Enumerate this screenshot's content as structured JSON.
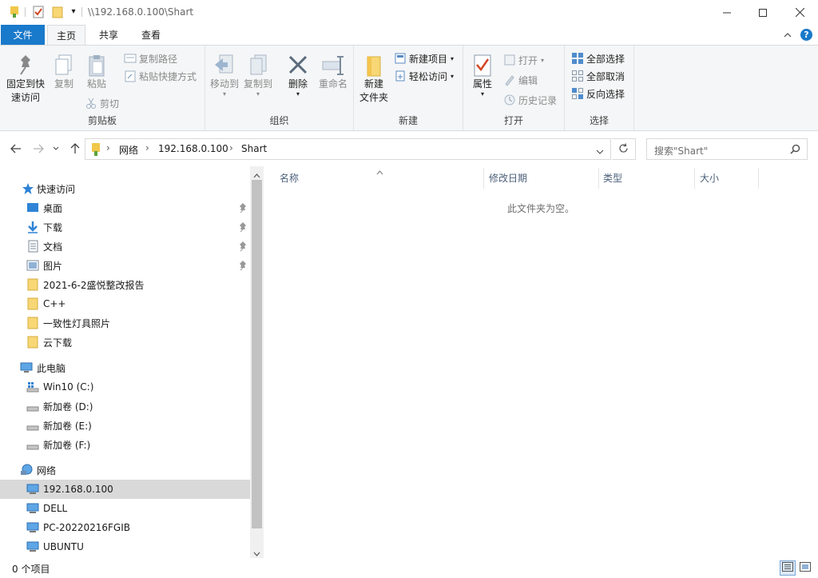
{
  "window": {
    "title": "\\\\192.168.0.100\\Shart"
  },
  "tabs": {
    "file": "文件",
    "home": "主页",
    "share": "共享",
    "view": "查看"
  },
  "ribbon": {
    "clipboard": {
      "label": "剪贴板",
      "pin_quick_access_line1": "固定到快",
      "pin_quick_access_line2": "速访问",
      "copy": "复制",
      "paste": "粘贴",
      "copy_path": "复制路径",
      "paste_shortcut": "粘贴快捷方式",
      "cut": "剪切"
    },
    "organize": {
      "label": "组织",
      "move_to": "移动到",
      "copy_to": "复制到",
      "delete": "删除",
      "rename": "重命名"
    },
    "new": {
      "label": "新建",
      "new_folder_line1": "新建",
      "new_folder_line2": "文件夹",
      "new_item": "新建项目",
      "easy_access": "轻松访问"
    },
    "open": {
      "label": "打开",
      "properties": "属性",
      "open": "打开",
      "edit": "编辑",
      "history": "历史记录"
    },
    "select": {
      "label": "选择",
      "select_all": "全部选择",
      "select_none": "全部取消",
      "invert": "反向选择"
    }
  },
  "address": {
    "crumbs": [
      "网络",
      "192.168.0.100",
      "Shart"
    ],
    "search_placeholder": "搜索\"Shart\""
  },
  "sidebar": {
    "quick_access": "快速访问",
    "quick_items": [
      {
        "label": "桌面",
        "pinned": true
      },
      {
        "label": "下载",
        "pinned": true
      },
      {
        "label": "文档",
        "pinned": true
      },
      {
        "label": "图片",
        "pinned": true
      },
      {
        "label": "2021-6-2盛悦整改报告",
        "pinned": false
      },
      {
        "label": "C++",
        "pinned": false
      },
      {
        "label": "一致性灯具照片",
        "pinned": false
      },
      {
        "label": "云下载",
        "pinned": false
      }
    ],
    "this_pc": "此电脑",
    "drives": [
      "Win10 (C:)",
      "新加卷 (D:)",
      "新加卷 (E:)",
      "新加卷 (F:)"
    ],
    "network": "网络",
    "network_items": [
      "192.168.0.100",
      "DELL",
      "PC-20220216FGIB",
      "UBUNTU"
    ],
    "selected": "192.168.0.100"
  },
  "content": {
    "columns": [
      "名称",
      "修改日期",
      "类型",
      "大小"
    ],
    "empty_message": "此文件夹为空。"
  },
  "status": {
    "item_count": "0 个项目"
  },
  "colors": {
    "accent": "#1979ca",
    "folder": "#f8d775",
    "selected_bg": "#d9d9d9"
  }
}
